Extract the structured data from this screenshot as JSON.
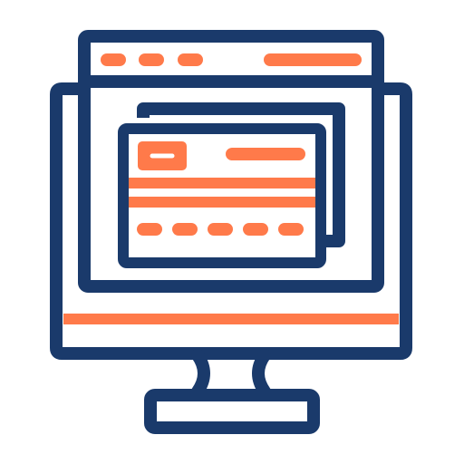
{
  "icon": {
    "name": "online-payment-card-icon",
    "colors": {
      "outline": "#1a3a6b",
      "accent": "#ff7a4a",
      "background": "#ffffff"
    }
  }
}
